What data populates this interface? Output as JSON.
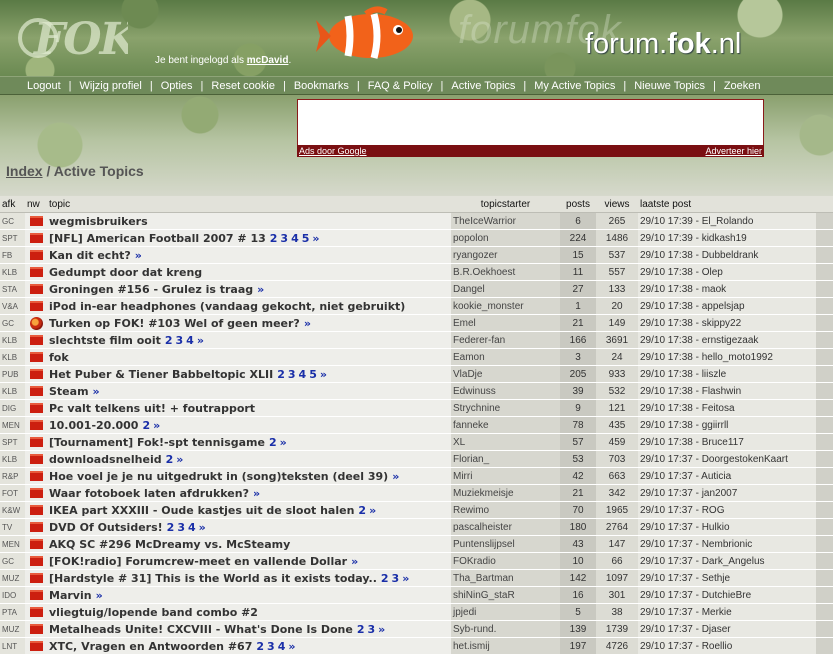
{
  "header": {
    "login_prefix": "Je bent ingelogd als",
    "username": "mcDavid",
    "login_suffix": ".",
    "site_name_plain": "forum.",
    "site_name_bold": "fok",
    "site_name_tld": ".nl",
    "watermark": "forumfok"
  },
  "nav": [
    "Logout",
    "Wijzig profiel",
    "Opties",
    "Reset cookie",
    "Bookmarks",
    "FAQ & Policy",
    "Active Topics",
    "My Active Topics",
    "Nieuwe Topics",
    "Zoeken"
  ],
  "ad": {
    "left": "Ads door Google",
    "right": "Adverteer hier"
  },
  "breadcrumb": {
    "index": "Index",
    "sep": "/",
    "current": "Active Topics"
  },
  "columns": {
    "afk": "afk",
    "nw": "nw",
    "topic": "topic",
    "starter": "topicstarter",
    "posts": "posts",
    "views": "views",
    "last": "laatste post"
  },
  "topics": [
    {
      "afk": "GC",
      "icon": "folder",
      "title": "wegmisbruikers",
      "pages": [],
      "more": false,
      "starter": "TheIceWarrior",
      "posts": "6",
      "views": "265",
      "last": "29/10 17:39 - El_Rolando"
    },
    {
      "afk": "SPT",
      "icon": "folder",
      "title": "[NFL] American Football 2007 # 13",
      "pages": [
        "2",
        "3",
        "4",
        "5"
      ],
      "more": true,
      "starter": "popolon",
      "posts": "224",
      "views": "1486",
      "last": "29/10 17:39 - kidkash19"
    },
    {
      "afk": "FB",
      "icon": "folder",
      "title": "Kan dit echt?",
      "pages": [],
      "more": true,
      "starter": "ryangozer",
      "posts": "15",
      "views": "537",
      "last": "29/10 17:38 - Dubbeldrank"
    },
    {
      "afk": "KLB",
      "icon": "folder",
      "title": "Gedumpt door dat kreng",
      "pages": [],
      "more": false,
      "starter": "B.R.Oekhoest",
      "posts": "11",
      "views": "557",
      "last": "29/10 17:38 - Olep"
    },
    {
      "afk": "STA",
      "icon": "folder",
      "title": "Groningen #156 - Grulez is traag",
      "pages": [],
      "more": true,
      "starter": "Dangel",
      "posts": "27",
      "views": "133",
      "last": "29/10 17:38 - maok"
    },
    {
      "afk": "V&A",
      "icon": "folder",
      "title": "iPod in-ear headphones (vandaag gekocht, niet gebruikt)",
      "pages": [],
      "more": false,
      "starter": "kookie_monster",
      "posts": "1",
      "views": "20",
      "last": "29/10 17:38 - appelsjap"
    },
    {
      "afk": "GC",
      "icon": "hot",
      "title": "Turken op FOK! #103 Wel of geen meer?",
      "pages": [],
      "more": true,
      "starter": "Emel",
      "posts": "21",
      "views": "149",
      "last": "29/10 17:38 - skippy22"
    },
    {
      "afk": "KLB",
      "icon": "folder",
      "title": "slechtste film ooit",
      "pages": [
        "2",
        "3",
        "4"
      ],
      "more": true,
      "starter": "Federer-fan",
      "posts": "166",
      "views": "3691",
      "last": "29/10 17:38 - ernstigezaak"
    },
    {
      "afk": "KLB",
      "icon": "folder",
      "title": "fok",
      "pages": [],
      "more": false,
      "starter": "Eamon",
      "posts": "3",
      "views": "24",
      "last": "29/10 17:38 - hello_moto1992"
    },
    {
      "afk": "PUB",
      "icon": "folder",
      "title": "Het Puber & Tiener Babbeltopic XLII",
      "pages": [
        "2",
        "3",
        "4",
        "5"
      ],
      "more": true,
      "starter": "VlaDje",
      "posts": "205",
      "views": "933",
      "last": "29/10 17:38 - liiszle"
    },
    {
      "afk": "KLB",
      "icon": "folder",
      "title": "Steam",
      "pages": [],
      "more": true,
      "starter": "Edwinuss",
      "posts": "39",
      "views": "532",
      "last": "29/10 17:38 - Flashwin"
    },
    {
      "afk": "DIG",
      "icon": "folder",
      "title": "Pc valt telkens uit! + foutrapport",
      "pages": [],
      "more": false,
      "starter": "Strychnine",
      "posts": "9",
      "views": "121",
      "last": "29/10 17:38 - Feitosa"
    },
    {
      "afk": "MEN",
      "icon": "folder",
      "title": "10.001-20.000",
      "pages": [
        "2"
      ],
      "more": true,
      "starter": "fanneke",
      "posts": "78",
      "views": "435",
      "last": "29/10 17:38 - ggiirrll"
    },
    {
      "afk": "SPT",
      "icon": "folder",
      "title": "[Tournament] Fok!-spt tennisgame",
      "pages": [
        "2"
      ],
      "more": true,
      "starter": "XL",
      "posts": "57",
      "views": "459",
      "last": "29/10 17:38 - Bruce117"
    },
    {
      "afk": "KLB",
      "icon": "folder",
      "title": "downloadsnelheid",
      "pages": [
        "2"
      ],
      "more": true,
      "starter": "Florian_",
      "posts": "53",
      "views": "703",
      "last": "29/10 17:37 - DoorgestokenKaart"
    },
    {
      "afk": "R&P",
      "icon": "folder",
      "title": "Hoe voel je je nu uitgedrukt in (song)teksten (deel 39)",
      "pages": [],
      "more": true,
      "starter": "Mirri",
      "posts": "42",
      "views": "663",
      "last": "29/10 17:37 - Auticia"
    },
    {
      "afk": "FOT",
      "icon": "folder",
      "title": "Waar fotoboek laten afdrukken?",
      "pages": [],
      "more": true,
      "starter": "Muziekmeisje",
      "posts": "21",
      "views": "342",
      "last": "29/10 17:37 - jan2007"
    },
    {
      "afk": "K&W",
      "icon": "folder",
      "title": "IKEA part XXXIII - Oude kastjes uit de sloot halen",
      "pages": [
        "2"
      ],
      "more": true,
      "starter": "Rewimo",
      "posts": "70",
      "views": "1965",
      "last": "29/10 17:37 - ROG"
    },
    {
      "afk": "TV",
      "icon": "folder",
      "title": "DVD Of Outsiders!",
      "pages": [
        "2",
        "3",
        "4"
      ],
      "more": true,
      "starter": "pascalheister",
      "posts": "180",
      "views": "2764",
      "last": "29/10 17:37 - Hulkio"
    },
    {
      "afk": "MEN",
      "icon": "folder",
      "title": "AKQ SC #296 McDreamy vs. McSteamy",
      "pages": [],
      "more": false,
      "starter": "Puntenslijpsel",
      "posts": "43",
      "views": "147",
      "last": "29/10 17:37 - Nembrionic"
    },
    {
      "afk": "GC",
      "icon": "folder",
      "title": "[FOK!radio] Forumcrew-meet en vallende Dollar",
      "pages": [],
      "more": true,
      "starter": "FOKradio",
      "posts": "10",
      "views": "66",
      "last": "29/10 17:37 - Dark_Angelus"
    },
    {
      "afk": "MUZ",
      "icon": "folder",
      "title": "[Hardstyle # 31] This is the World as it exists today..",
      "pages": [
        "2",
        "3"
      ],
      "more": true,
      "starter": "Tha_Bartman",
      "posts": "142",
      "views": "1097",
      "last": "29/10 17:37 - Sethje"
    },
    {
      "afk": "IDO",
      "icon": "folder",
      "title": "Marvin",
      "pages": [],
      "more": true,
      "starter": "shiNinG_staR",
      "posts": "16",
      "views": "301",
      "last": "29/10 17:37 - DutchieBre"
    },
    {
      "afk": "PTA",
      "icon": "folder",
      "title": "vliegtuig/lopende band combo #2",
      "pages": [],
      "more": false,
      "starter": "jpjedi",
      "posts": "5",
      "views": "38",
      "last": "29/10 17:37 - Merkie"
    },
    {
      "afk": "MUZ",
      "icon": "folder",
      "title": "Metalheads Unite! CXCVIII - What's Done Is Done",
      "pages": [
        "2",
        "3"
      ],
      "more": true,
      "starter": "Syb-rund.",
      "posts": "139",
      "views": "1739",
      "last": "29/10 17:37 - Djaser"
    },
    {
      "afk": "LNT",
      "icon": "folder",
      "title": "XTC, Vragen en Antwoorden #67",
      "pages": [
        "2",
        "3",
        "4"
      ],
      "more": true,
      "starter": "het.ismij",
      "posts": "197",
      "views": "4726",
      "last": "29/10 17:37 - Roellio"
    }
  ]
}
